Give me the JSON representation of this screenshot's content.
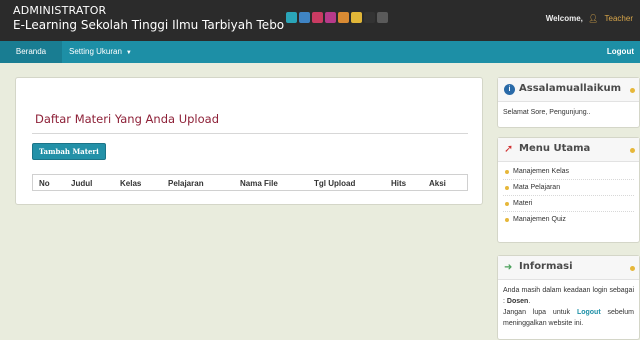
{
  "header": {
    "role": "ADMINISTRATOR",
    "site_title": "E-Learning Sekolah Tinggi Ilmu Tarbiyah Tebo",
    "theme_colors": [
      "#2aa5b8",
      "#3f84c4",
      "#c93b62",
      "#b73a8a",
      "#d88a33",
      "#e1b638",
      "#333333",
      "#5a5a5a"
    ],
    "welcome_label": "Welcome,",
    "user_name": "Teacher"
  },
  "nav": {
    "home_label": "Beranda",
    "setting_label": "Setting Ukuran",
    "logout_label": "Logout"
  },
  "main": {
    "title": "Daftar Materi Yang Anda Upload",
    "add_button_label": "Tambah Materi",
    "table_headers": [
      "No",
      "Judul",
      "Kelas",
      "Pelajaran",
      "Nama File",
      "Tgl Upload",
      "Hits",
      "Aksi"
    ]
  },
  "sidebar": {
    "greeting": {
      "title": "Assalamuallaikum",
      "text": "Selamat Sore, Pengunjung.."
    },
    "menu": {
      "title": "Menu Utama",
      "items": [
        "Manajemen Kelas",
        "Mata Pelajaran",
        "Materi",
        "Manajemen Quiz"
      ]
    },
    "info": {
      "title": "Informasi",
      "line1": "Anda masih dalam keadaan login sebagai :",
      "role": "Dosen",
      "line2_pre": "Jangan lupa untuk",
      "logout_word": "Logout",
      "line2_post": "sebelum meninggalkan website ini."
    }
  }
}
